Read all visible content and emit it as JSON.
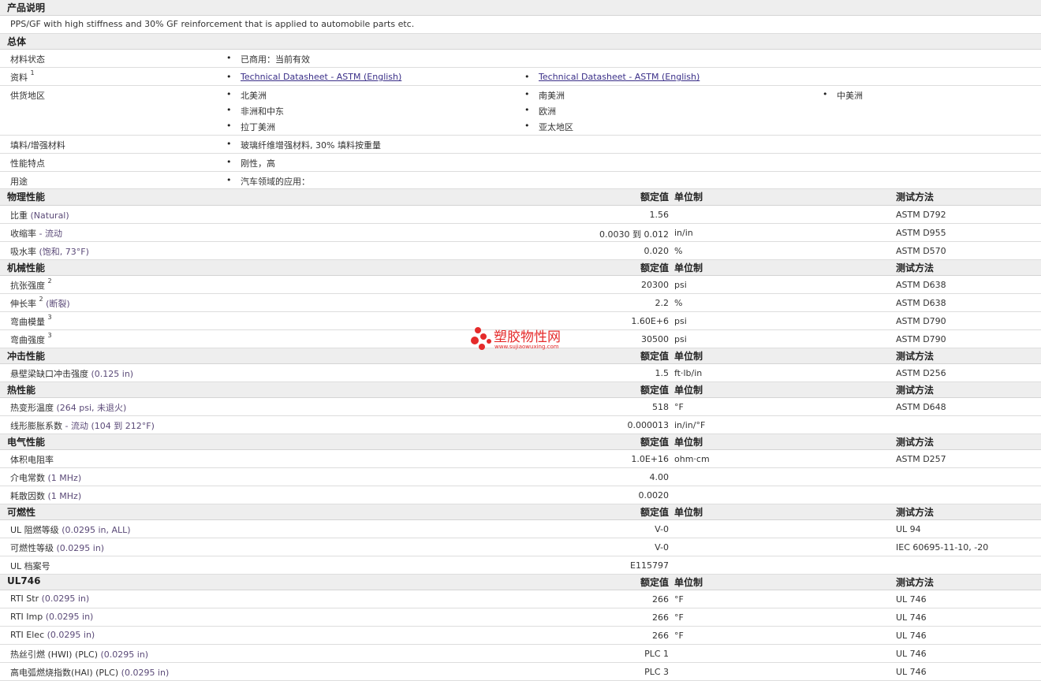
{
  "product_description": {
    "title": "产品说明",
    "text": "PPS/GF with high stiffness and 30% GF reinforcement that is applied to automobile parts etc."
  },
  "general": {
    "title": "总体",
    "material_status": {
      "label": "材料状态",
      "value": "已商用：当前有效"
    },
    "documents": {
      "label": "资料",
      "sup": "1",
      "links": [
        "Technical Datasheet - ASTM (English)",
        "Technical Datasheet - ASTM (English)"
      ]
    },
    "availability": {
      "label": "供货地区",
      "regions": [
        "北美洲",
        "南美洲",
        "中美洲",
        "非洲和中东",
        "欧洲",
        "拉丁美洲",
        "亚太地区"
      ]
    },
    "filler": {
      "label": "填料/增强材料",
      "value": "玻璃纤维增强材料, 30% 填料按重量"
    },
    "features": {
      "label": "性能特点",
      "value": "刚性，高"
    },
    "uses": {
      "label": "用途",
      "value": "汽车领域的应用："
    }
  },
  "headers": {
    "nominal": "额定值",
    "unit": "单位制",
    "method": "测试方法"
  },
  "physical": {
    "title": "物理性能",
    "rows": [
      {
        "label": "比重",
        "cond": "(Natural)",
        "value": "1.56",
        "unit": "",
        "method": "ASTM D792"
      },
      {
        "label": "收缩率",
        "cond": "- 流动",
        "value": "0.0030 到  0.012",
        "unit": "in/in",
        "method": "ASTM D955"
      },
      {
        "label": "吸水率",
        "cond": "(饱和, 73°F)",
        "value": "0.020",
        "unit": "%",
        "method": "ASTM D570"
      }
    ]
  },
  "mechanical": {
    "title": "机械性能",
    "rows": [
      {
        "label": "抗张强度",
        "sup": "2",
        "cond": "",
        "value": "20300",
        "unit": "psi",
        "method": "ASTM D638"
      },
      {
        "label": "伸长率",
        "sup": "2",
        "cond": "(断裂)",
        "value": "2.2",
        "unit": "%",
        "method": "ASTM D638"
      },
      {
        "label": "弯曲模量",
        "sup": "3",
        "cond": "",
        "value": "1.60E+6",
        "unit": "psi",
        "method": "ASTM D790"
      },
      {
        "label": "弯曲强度",
        "sup": "3",
        "cond": "",
        "value": "30500",
        "unit": "psi",
        "method": "ASTM D790"
      }
    ]
  },
  "impact": {
    "title": "冲击性能",
    "rows": [
      {
        "label": "悬壁梁缺口冲击强度",
        "cond": "(0.125 in)",
        "value": "1.5",
        "unit": "ft·lb/in",
        "method": "ASTM D256"
      }
    ]
  },
  "thermal": {
    "title": "热性能",
    "rows": [
      {
        "label": "热变形温度",
        "cond": "(264 psi, 未退火)",
        "value": "518",
        "unit": "°F",
        "method": "ASTM D648"
      },
      {
        "label": "线形膨胀系数",
        "cond": "- 流动 (104 到 212°F)",
        "value": "0.000013",
        "unit": "in/in/°F",
        "method": ""
      }
    ]
  },
  "electrical": {
    "title": "电气性能",
    "rows": [
      {
        "label": "体积电阻率",
        "cond": "",
        "value": "1.0E+16",
        "unit": "ohm·cm",
        "method": "ASTM D257"
      },
      {
        "label": "介电常数",
        "cond": "(1 MHz)",
        "value": "4.00",
        "unit": "",
        "method": ""
      },
      {
        "label": "耗散因数",
        "cond": "(1 MHz)",
        "value": "0.0020",
        "unit": "",
        "method": ""
      }
    ]
  },
  "flammability": {
    "title": "可燃性",
    "rows": [
      {
        "label": "UL 阻燃等级",
        "cond": "(0.0295 in, ALL)",
        "value": "V-0",
        "unit": "",
        "method": "UL 94"
      },
      {
        "label": "可燃性等级",
        "cond": "(0.0295 in)",
        "value": "V-0",
        "unit": "",
        "method": "IEC 60695-11-10, -20"
      },
      {
        "label": "UL 档案号",
        "cond": "",
        "value": "E115797",
        "unit": "",
        "method": ""
      }
    ]
  },
  "ul746": {
    "title": "UL746",
    "rows": [
      {
        "label": "RTI Str",
        "cond": "(0.0295 in)",
        "value": "266",
        "unit": "°F",
        "method": "UL 746"
      },
      {
        "label": "RTI Imp",
        "cond": "(0.0295 in)",
        "value": "266",
        "unit": "°F",
        "method": "UL 746"
      },
      {
        "label": "RTI Elec",
        "cond": "(0.0295 in)",
        "value": "266",
        "unit": "°F",
        "method": "UL 746"
      },
      {
        "label": "热丝引燃 (HWI) (PLC)",
        "cond": "(0.0295 in)",
        "value": "PLC 1",
        "unit": "",
        "method": "UL 746"
      },
      {
        "label": "高电弧燃烧指数(HAI) (PLC)",
        "cond": "(0.0295 in)",
        "value": "PLC 3",
        "unit": "",
        "method": "UL 746"
      }
    ]
  },
  "watermark": {
    "brand": "塑胶物性网",
    "url": "www.sujiaowuxing.com",
    "color": "#e52b2b"
  }
}
